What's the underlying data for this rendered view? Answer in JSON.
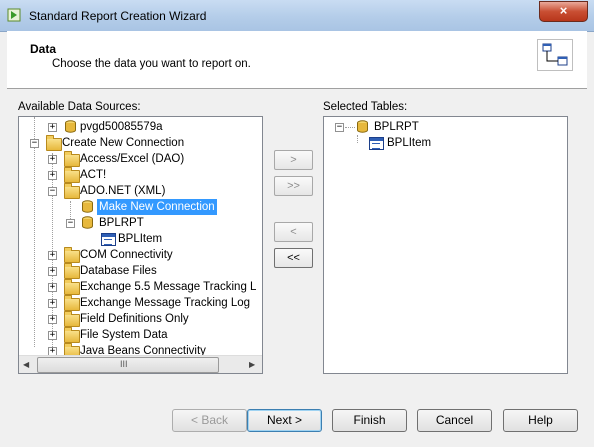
{
  "window": {
    "title": "Standard Report Creation Wizard",
    "close_glyph": "×"
  },
  "header": {
    "title": "Data",
    "description": "Choose the data you want to report on."
  },
  "available": {
    "label": "Available Data Sources:",
    "items": [
      {
        "label": "pvgd50085579a",
        "icon": "database-icon",
        "expander": "+"
      },
      {
        "label": "Create New Connection",
        "icon": "folder-icon",
        "expander": "−"
      },
      {
        "label": "Access/Excel (DAO)",
        "icon": "folder-icon",
        "expander": "+"
      },
      {
        "label": "ACT!",
        "icon": "folder-icon",
        "expander": "+"
      },
      {
        "label": "ADO.NET (XML)",
        "icon": "folder-icon",
        "expander": "−"
      },
      {
        "label": "Make New Connection",
        "icon": "database-icon",
        "expander": ""
      },
      {
        "label": "BPLRPT",
        "icon": "database-icon",
        "expander": "−"
      },
      {
        "label": "BPLItem",
        "icon": "table-icon",
        "expander": ""
      },
      {
        "label": "COM Connectivity",
        "icon": "folder-icon",
        "expander": "+"
      },
      {
        "label": "Database Files",
        "icon": "folder-icon",
        "expander": "+"
      },
      {
        "label": "Exchange 5.5 Message Tracking L",
        "icon": "folder-icon",
        "expander": "+"
      },
      {
        "label": "Exchange Message Tracking Log",
        "icon": "folder-icon",
        "expander": "+"
      },
      {
        "label": "Field Definitions Only",
        "icon": "folder-icon",
        "expander": "+"
      },
      {
        "label": "File System Data",
        "icon": "folder-icon",
        "expander": "+"
      },
      {
        "label": "Java Beans Connectivity",
        "icon": "folder-icon",
        "expander": "+"
      }
    ]
  },
  "selected": {
    "label": "Selected Tables:",
    "items": [
      {
        "label": "BPLRPT",
        "icon": "database-icon",
        "expander": "−"
      },
      {
        "label": "BPLItem",
        "icon": "table-icon",
        "expander": ""
      }
    ]
  },
  "transfer": {
    "add": ">",
    "add_all": ">>",
    "remove": "<",
    "remove_all": "<<"
  },
  "buttons": {
    "back": "< Back",
    "next": "Next >",
    "finish": "Finish",
    "cancel": "Cancel",
    "help": "Help"
  },
  "scroll": {
    "up": "▲",
    "down": "▼",
    "left": "◀",
    "right": "▶",
    "grip_v": "≡",
    "grip_h": "III"
  }
}
